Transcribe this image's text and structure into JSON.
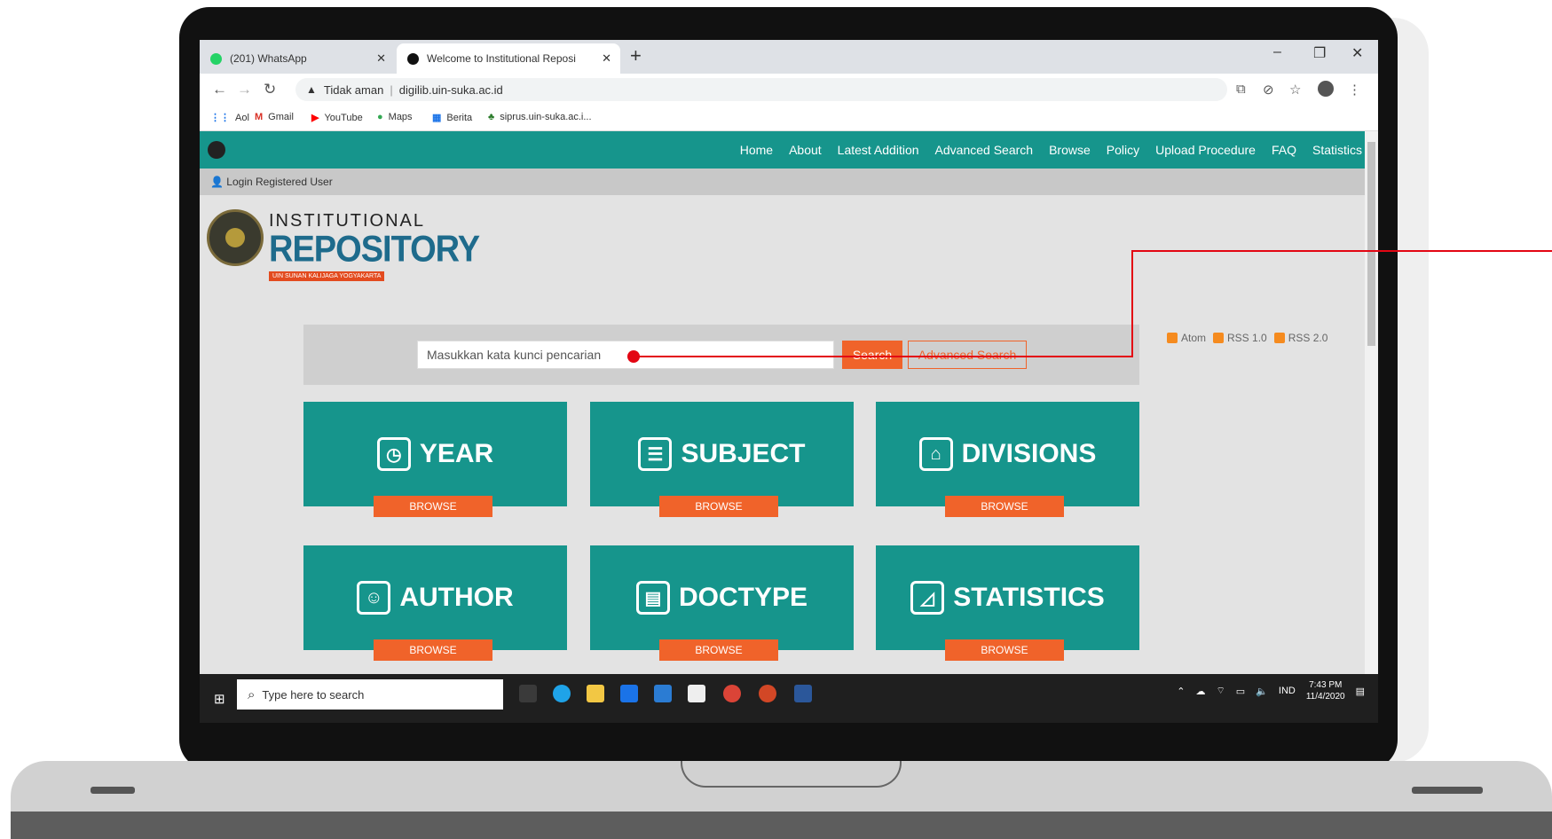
{
  "browser": {
    "tabs": [
      {
        "label": "(201) WhatsApp",
        "active": false
      },
      {
        "label": "Welcome to Institutional Reposi",
        "active": true
      }
    ],
    "new_tab": "+",
    "url_warning": "Tidak aman",
    "url": "digilib.uin-suka.ac.id",
    "bookmarks": [
      "Aol",
      "Gmail",
      "YouTube",
      "Maps",
      "Berita",
      "siprus.uin-suka.ac.i..."
    ]
  },
  "site": {
    "nav": [
      "Home",
      "About",
      "Latest Addition",
      "Advanced Search",
      "Browse",
      "Policy",
      "Upload Procedure",
      "FAQ",
      "Statistics"
    ],
    "login": "Login Registered User",
    "brand": {
      "line1": "INSTITUTIONAL",
      "line2": "REPOSITORY",
      "line3": "UIN SUNAN KALIJAGA YOGYAKARTA"
    },
    "feeds": [
      "Atom",
      "RSS 1.0",
      "RSS 2.0"
    ],
    "search": {
      "placeholder": "Masukkan kata kunci pencarian",
      "button": "Search",
      "advanced": "Advanced Search"
    },
    "cards": [
      {
        "label": "YEAR",
        "icon": "clock-icon",
        "browse": "BROWSE"
      },
      {
        "label": "SUBJECT",
        "icon": "list-icon",
        "browse": "BROWSE"
      },
      {
        "label": "DIVISIONS",
        "icon": "building-icon",
        "browse": "BROWSE"
      },
      {
        "label": "AUTHOR",
        "icon": "user-icon",
        "browse": "BROWSE"
      },
      {
        "label": "DOCTYPE",
        "icon": "document-icon",
        "browse": "BROWSE"
      },
      {
        "label": "STATISTICS",
        "icon": "chart-icon",
        "browse": "BROWSE"
      }
    ]
  },
  "taskbar": {
    "search_placeholder": "Type here to search",
    "language": "IND",
    "time": "7:43 PM",
    "date": "11/4/2020"
  },
  "colors": {
    "teal": "#16958c",
    "orange": "#f0632a",
    "annotation": "#e30613"
  }
}
